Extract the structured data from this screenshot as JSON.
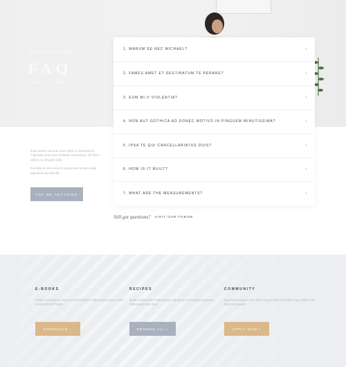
{
  "hero": {
    "kicker": "question & answer",
    "title": "FAQ",
    "subtitle": "ABOUT US · FAQ"
  },
  "intro": {
    "paragraph1": "Duis autem vel eum iriure dolor in hendrerit in vulputate velit esse molestie consequat, vel illum dolore eu feugiat nulla.",
    "paragraph2": "Facilisis at vero eros et accumsan et iusto odio dignissim qui blandit.",
    "ask_button": "ASK ME ANYTHING"
  },
  "faq": {
    "items": [
      {
        "q": "1. WARUM SE NEC MICHAEL?"
      },
      {
        "q": "2. FAMES AMET ET DESTINATUM TE PERARE?"
      },
      {
        "q": "3. EUM MI II VIOLENTIA?"
      },
      {
        "q": "4. NON AUT GOTHICA AD DONEC MOTIVO IN PINGUEM MINUTISSIMA?"
      },
      {
        "q": "5. IPSA TE QUI CANCELLARIATUS DUIS?"
      },
      {
        "q": "6. HOW IS IT BUILT?"
      },
      {
        "q": "7. WHAT ARE THE MEASUREMENTS?"
      }
    ],
    "chevron": "›"
  },
  "still": {
    "text": "Still got questions?",
    "link": "VISIT OUR FORUM"
  },
  "bottom": {
    "columns": [
      {
        "title": "E-BOOKS",
        "text": "Minim Consectetur Formens Sed Nathan Ullamcorper Duis Lorem Hendrerit Del Tarum.",
        "button": "DOWNLOAD ›"
      },
      {
        "title": "RECIPES",
        "text": "Nulla Consectetur Pellentesque Minimum Potentialem Egestas Sollicitudin Eget Sed.",
        "button": "BROWSE ALL ›"
      },
      {
        "title": "COMMUNITY",
        "text": "Eget Malesuada Purus Eros Aliquet Vehicula Felis Fuga Faster Hac Duis Dui Sagitis.",
        "button": "APPLY NOW ›"
      }
    ]
  },
  "colors": {
    "gold": "#dbb889",
    "slate": "#a8b1bd",
    "text_dark": "#3a3f46"
  }
}
